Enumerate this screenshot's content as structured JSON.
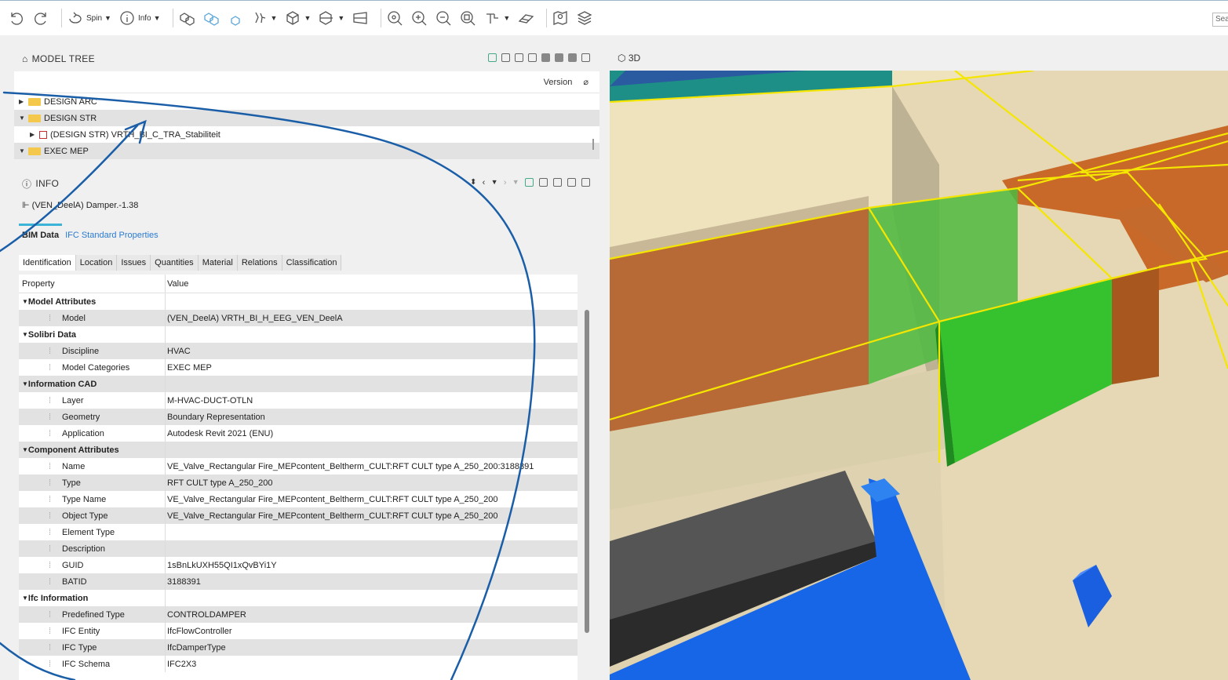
{
  "toolbar": {
    "spin_label": "Spin",
    "info_label": "Info",
    "search_placeholder": "Sea"
  },
  "model_tree": {
    "title": "MODEL TREE",
    "columns": [
      "Version"
    ],
    "rows": [
      {
        "label": "DESIGN ARC",
        "expanded": false
      },
      {
        "label": "DESIGN STR",
        "expanded": true
      },
      {
        "label": "(DESIGN STR) VRTH_BI_C_TRA_Stabiliteit",
        "expanded": false
      },
      {
        "label": "EXEC MEP",
        "expanded": true
      }
    ]
  },
  "info": {
    "title": "INFO",
    "selected": "(VEN_DeelA) Damper.-1.38",
    "tabs": [
      "BIM Data",
      "IFC Standard Properties"
    ],
    "subtabs": [
      "Identification",
      "Location",
      "Issues",
      "Quantities",
      "Material",
      "Relations",
      "Classification"
    ],
    "grid_header": {
      "property": "Property",
      "value": "Value"
    },
    "groups": [
      {
        "name": "Model Attributes",
        "rows": [
          {
            "p": "Model",
            "v": "(VEN_DeelA) VRTH_BI_H_EEG_VEN_DeelA"
          }
        ]
      },
      {
        "name": "Solibri Data",
        "rows": [
          {
            "p": "Discipline",
            "v": "HVAC"
          },
          {
            "p": "Model Categories",
            "v": "EXEC MEP"
          }
        ]
      },
      {
        "name": "Information CAD",
        "rows": [
          {
            "p": "Layer",
            "v": "M-HVAC-DUCT-OTLN"
          },
          {
            "p": "Geometry",
            "v": "Boundary Representation"
          },
          {
            "p": "Application",
            "v": "Autodesk Revit 2021 (ENU)"
          }
        ]
      },
      {
        "name": "Component Attributes",
        "rows": [
          {
            "p": "Name",
            "v": "VE_Valve_Rectangular Fire_MEPcontent_Beltherm_CULT:RFT CULT type A_250_200:3188391"
          },
          {
            "p": "Type",
            "v": "RFT CULT type A_250_200"
          },
          {
            "p": "Type Name",
            "v": "VE_Valve_Rectangular Fire_MEPcontent_Beltherm_CULT:RFT CULT type A_250_200"
          },
          {
            "p": "Object Type",
            "v": "VE_Valve_Rectangular Fire_MEPcontent_Beltherm_CULT:RFT CULT type A_250_200"
          },
          {
            "p": "Element Type",
            "v": ""
          },
          {
            "p": "Description",
            "v": ""
          },
          {
            "p": "GUID",
            "v": "1sBnLkUXH55QI1xQvBYi1Y"
          },
          {
            "p": "BATID",
            "v": "3188391"
          }
        ]
      },
      {
        "name": "Ifc Information",
        "rows": [
          {
            "p": "Predefined Type",
            "v": "CONTROLDAMPER"
          },
          {
            "p": "IFC Entity",
            "v": "IfcFlowController"
          },
          {
            "p": "IFC Type",
            "v": "IfcDamperType"
          },
          {
            "p": "IFC Schema",
            "v": "IFC2X3"
          }
        ]
      }
    ]
  },
  "view3d": {
    "title": "3D"
  },
  "colors": {
    "accent": "#3cb4d8",
    "annotation": "#1a5ea8",
    "selection": "#f5e600"
  }
}
